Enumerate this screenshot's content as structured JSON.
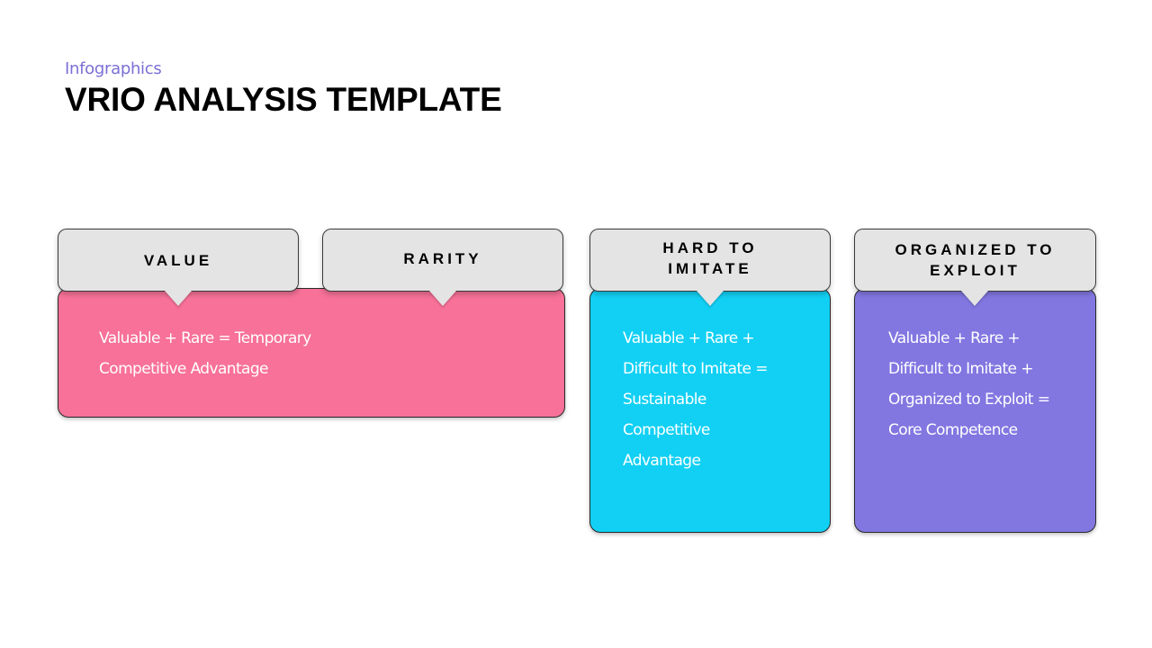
{
  "header": {
    "subtitle": "Infographics",
    "title": "VRIO ANALYSIS TEMPLATE"
  },
  "colors": {
    "subtitle": "#7b6fd6",
    "header_box": "#e4e4e4",
    "pink": "#f77198",
    "cyan": "#12d0f4",
    "purple": "#8277e1"
  },
  "columns": [
    {
      "label": "VALUE"
    },
    {
      "label": "RARITY"
    },
    {
      "label": "HARD TO IMITATE"
    },
    {
      "label": "ORGANIZED TO EXPLOIT"
    }
  ],
  "boxes": {
    "pink": {
      "lines": [
        "Valuable + Rare = Temporary",
        "Competitive Advantage"
      ]
    },
    "cyan": {
      "lines": [
        "Valuable + Rare +",
        "Difficult to Imitate =",
        "Sustainable",
        "Competitive",
        "Advantage"
      ]
    },
    "purple": {
      "lines": [
        "Valuable + Rare +",
        "Difficult to Imitate +",
        "Organized to Exploit =",
        "Core Competence"
      ]
    }
  }
}
